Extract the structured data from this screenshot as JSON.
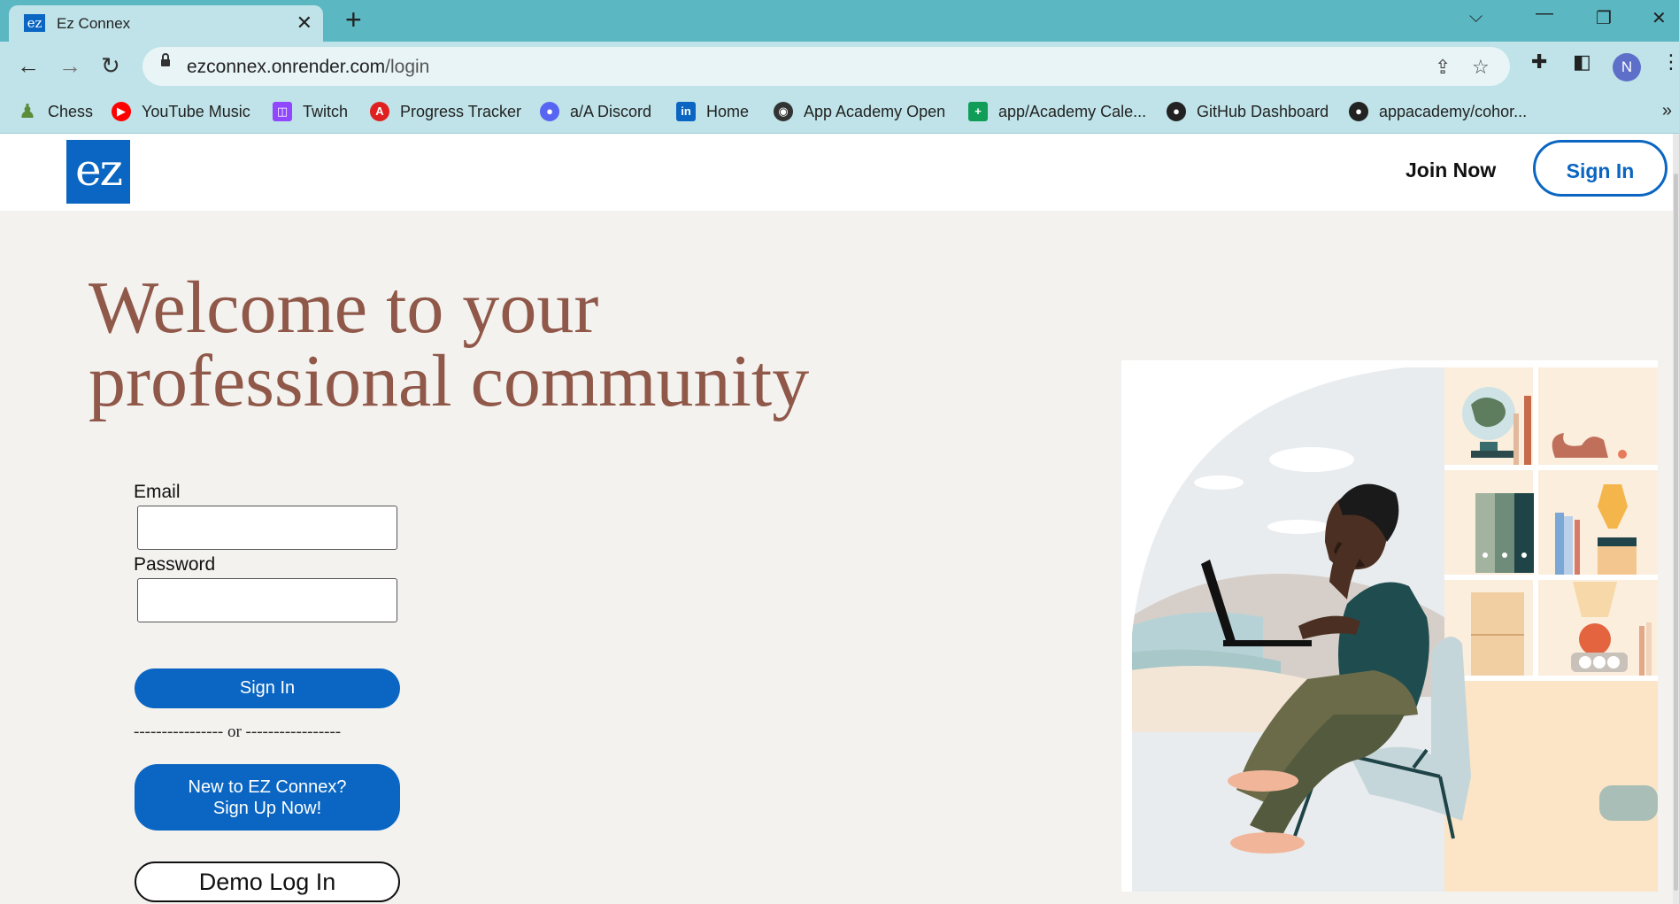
{
  "browser": {
    "tab_title": "Ez Connex",
    "tab_favicon_text": "ez",
    "url_host": "ezconnex.onrender.com",
    "url_path": "/login",
    "profile_initial": "N",
    "bookmarks": [
      {
        "label": "Chess",
        "icon": "chess-pawn-icon",
        "color": "#5b8c3a"
      },
      {
        "label": "YouTube Music",
        "icon": "youtube-music-icon",
        "color": "#ff0000"
      },
      {
        "label": "Twitch",
        "icon": "twitch-icon",
        "color": "#9146ff"
      },
      {
        "label": "Progress Tracker",
        "icon": "progress-tracker-icon",
        "color": "#e02020"
      },
      {
        "label": "a/A Discord",
        "icon": "discord-icon",
        "color": "#5865f2"
      },
      {
        "label": "Home",
        "icon": "linkedin-icon",
        "color": "#0a66c2"
      },
      {
        "label": "App Academy Open",
        "icon": "globe-icon",
        "color": "#333333"
      },
      {
        "label": "app/Academy Cale...",
        "icon": "sheets-icon",
        "color": "#0f9d58"
      },
      {
        "label": "GitHub Dashboard",
        "icon": "github-icon",
        "color": "#222222"
      },
      {
        "label": "appacademy/cohor...",
        "icon": "github-icon",
        "color": "#222222"
      }
    ]
  },
  "header": {
    "logo_text": "ez",
    "join_label": "Join Now",
    "signin_label": "Sign In"
  },
  "hero": {
    "line1": "Welcome to your",
    "line2": "professional community"
  },
  "form": {
    "email_label": "Email",
    "email_value": "",
    "password_label": "Password",
    "password_value": "",
    "signin_label": "Sign In",
    "divider_text": "---------------- or -----------------",
    "signup_line1": "New to EZ Connex?",
    "signup_line2": "Sign Up Now!",
    "demo_label": "Demo Log In"
  },
  "colors": {
    "brand_blue": "#0a66c2",
    "headline": "#8f5849",
    "page_bg": "#f3f2ef",
    "chrome_teal": "#5bb8c3",
    "chrome_light": "#bfe3e8"
  }
}
